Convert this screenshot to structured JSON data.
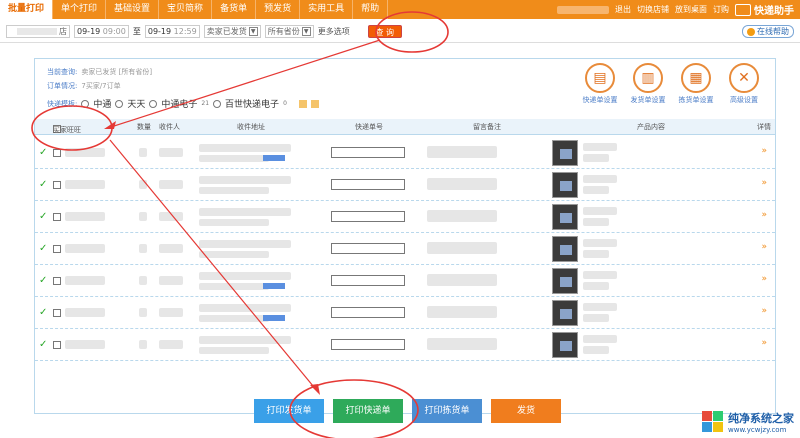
{
  "nav": {
    "tabs": [
      "批量打印",
      "单个打印",
      "基础设置",
      "宝贝简称",
      "备货单",
      "预发货",
      "实用工具",
      "帮助"
    ],
    "right": [
      "退出",
      "切换店铺",
      "放到桌面",
      "订购"
    ],
    "brand": "快递助手"
  },
  "filters": {
    "shop_suffix": "店",
    "date_from": "09-19",
    "time_from": "09:00",
    "to_word": "至",
    "date_to": "09-19",
    "time_to": "12:59",
    "status": "卖家已发货",
    "province": "所有省份",
    "more": "更多选项",
    "query": "查 询",
    "help": "在线帮助"
  },
  "info": {
    "current_query_label": "当前查询:",
    "current_query_value": "卖家已发货 [所有省份]",
    "order_label": "订单情况:",
    "order_value": "7买家/7订单",
    "express_label": "快递模板:",
    "express_options": [
      {
        "label": "中通",
        "sup": ""
      },
      {
        "label": "天天",
        "sup": ""
      },
      {
        "label": "中通电子",
        "sup": "21"
      },
      {
        "label": "百世快递电子",
        "sup": "0"
      }
    ]
  },
  "tools": [
    "快递单设置",
    "发货单设置",
    "拣货单设置",
    "高级设置"
  ],
  "table": {
    "headers": [
      "买家旺旺",
      "数量",
      "收件人",
      "收件地址",
      "快递单号",
      "留言备注",
      "产品内容",
      "详情"
    ],
    "rows": [
      {
        "tracking": "",
        "has_blue": true
      },
      {
        "tracking": "",
        "has_blue": false
      },
      {
        "tracking": "",
        "has_blue": false
      },
      {
        "tracking": "",
        "has_blue": false
      },
      {
        "tracking": "",
        "has_blue": true
      },
      {
        "tracking": "",
        "has_blue": true
      },
      {
        "tracking": "",
        "has_blue": false
      }
    ]
  },
  "actions": [
    "打印发货单",
    "打印快递单",
    "打印拣货单",
    "发货"
  ],
  "watermark": {
    "title": "纯净系统之家",
    "url": "www.ycwjzy.com"
  },
  "colors": {
    "accent": "#f08c1a",
    "annotation": "#e53935"
  }
}
